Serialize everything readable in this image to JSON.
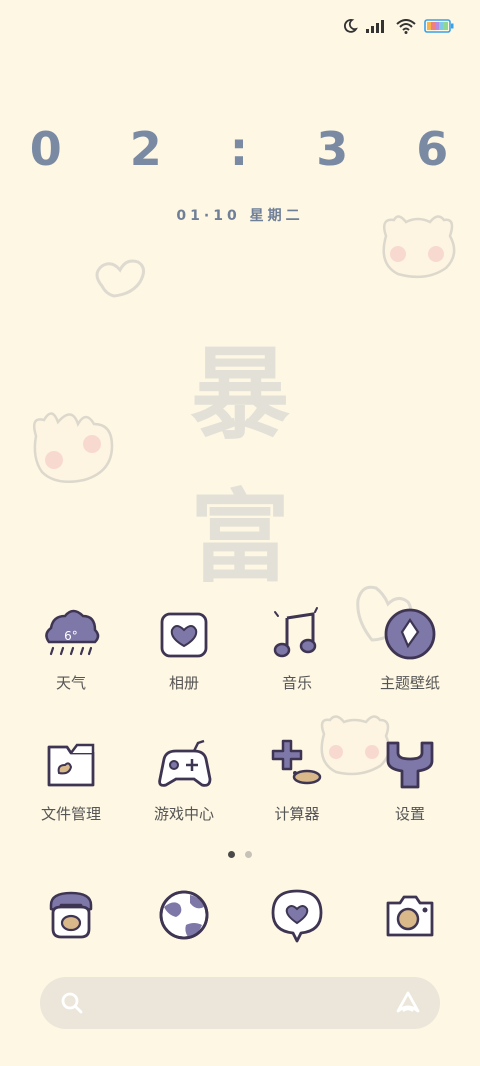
{
  "status_bar": {
    "icons": [
      "moon-icon",
      "signal-icon",
      "wifi-icon",
      "battery-icon"
    ]
  },
  "lockscreen": {
    "time": "0 2 : 3 6",
    "date": "01·10 星期二",
    "wallpaper_text_1": "暴",
    "wallpaper_text_2": "富"
  },
  "home": {
    "row1": [
      {
        "label": "天气",
        "icon": "weather-cloud-icon",
        "badge": "6°"
      },
      {
        "label": "相册",
        "icon": "gallery-heart-icon"
      },
      {
        "label": "音乐",
        "icon": "music-note-icon"
      },
      {
        "label": "主题壁纸",
        "icon": "theme-diamond-icon"
      }
    ],
    "row2": [
      {
        "label": "文件管理",
        "icon": "folder-icon"
      },
      {
        "label": "游戏中心",
        "icon": "gamepad-icon"
      },
      {
        "label": "计算器",
        "icon": "calculator-icon"
      },
      {
        "label": "设置",
        "icon": "wrench-icon"
      }
    ]
  },
  "pager": {
    "pages": 2,
    "current": 1
  },
  "dock": [
    "phone-icon",
    "browser-globe-icon",
    "message-heart-icon",
    "camera-icon"
  ],
  "search_bar": {
    "icons": [
      "search-icon",
      "assistant-icon"
    ]
  },
  "colors": {
    "background": "#fdf7e4",
    "icon_fill": "#7e78a8",
    "outline": "#3e3553",
    "accent": "#d9b98a"
  }
}
